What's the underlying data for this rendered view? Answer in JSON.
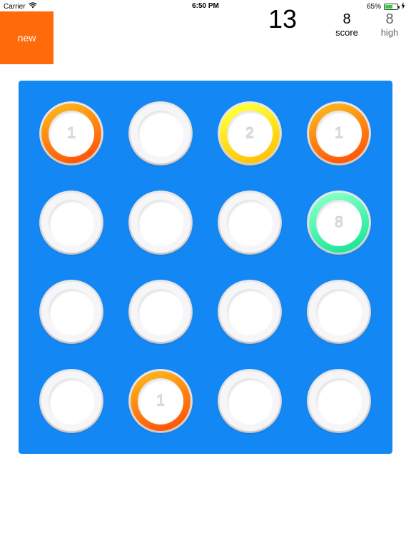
{
  "status_bar": {
    "carrier": "Carrier",
    "time": "6:50 PM",
    "battery_percent": "65%",
    "battery_level": 0.65
  },
  "header": {
    "new_label": "new",
    "moves": "13",
    "score_value": "8",
    "score_label": "score",
    "high_value": "8",
    "high_label": "high"
  },
  "colors": {
    "new_button": "#ff6a0a",
    "board": "#1388f5",
    "ring_orange": [
      "#ffae1a",
      "#ff5a0a"
    ],
    "ring_yellow": [
      "#ffff33",
      "#ffc40a"
    ],
    "ring_green": [
      "#7effc6",
      "#21e89a"
    ]
  },
  "board": {
    "rows": [
      [
        {
          "value": "1",
          "color": "orange"
        },
        {
          "value": "",
          "color": ""
        },
        {
          "value": "2",
          "color": "yellow"
        },
        {
          "value": "1",
          "color": "orange"
        }
      ],
      [
        {
          "value": "",
          "color": ""
        },
        {
          "value": "",
          "color": ""
        },
        {
          "value": "",
          "color": ""
        },
        {
          "value": "8",
          "color": "green"
        }
      ],
      [
        {
          "value": "",
          "color": ""
        },
        {
          "value": "",
          "color": ""
        },
        {
          "value": "",
          "color": ""
        },
        {
          "value": "",
          "color": ""
        }
      ],
      [
        {
          "value": "",
          "color": ""
        },
        {
          "value": "1",
          "color": "orange"
        },
        {
          "value": "",
          "color": ""
        },
        {
          "value": "",
          "color": ""
        }
      ]
    ]
  }
}
